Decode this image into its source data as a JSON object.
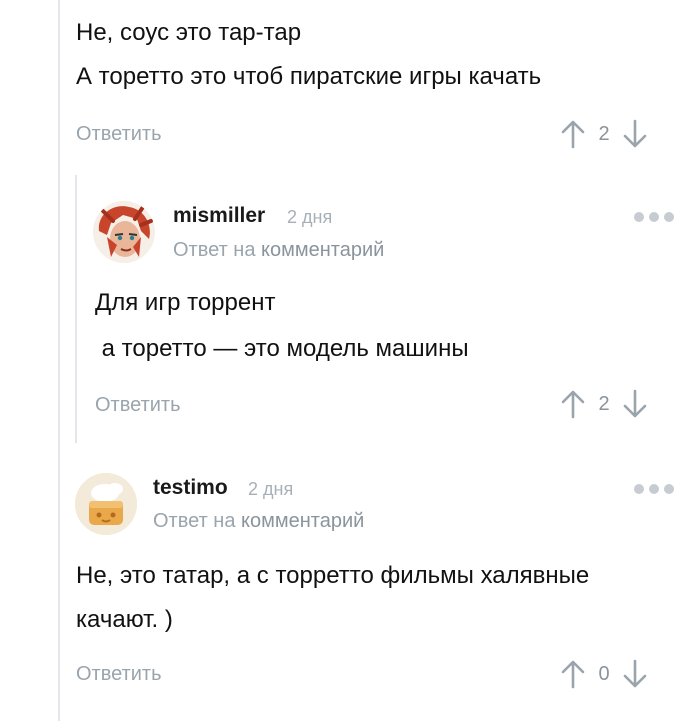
{
  "comment_top": {
    "lines": [
      "Не, соус это тар-тар",
      "А торетто это чтоб пиратские игры качать"
    ],
    "reply_label": "Ответить",
    "votes": "2"
  },
  "comment_mismiller": {
    "username": "mismiller",
    "time": "2 дня",
    "reply_prefix": "Ответ на",
    "reply_link": "комментарий",
    "lines": [
      "Для игр торрент",
      " а торетто — это модель машины"
    ],
    "reply_label": "Ответить",
    "votes": "2"
  },
  "comment_testimo": {
    "username": "testimo",
    "time": "2 дня",
    "reply_prefix": "Ответ на",
    "reply_link": "комментарий",
    "lines": [
      "Не, это татар, а с торретто фильмы халявные",
      "качают. )"
    ],
    "reply_label": "Ответить",
    "votes": "0"
  },
  "icons": {
    "upvote": "arrow-up-icon",
    "downvote": "arrow-down-icon",
    "more": "more-dots-icon"
  },
  "colors": {
    "thread_line": "#e3e6ea",
    "muted_text": "#9aa4ad",
    "arrow": "#9aa4ad",
    "dots": "#c6ccd2"
  }
}
